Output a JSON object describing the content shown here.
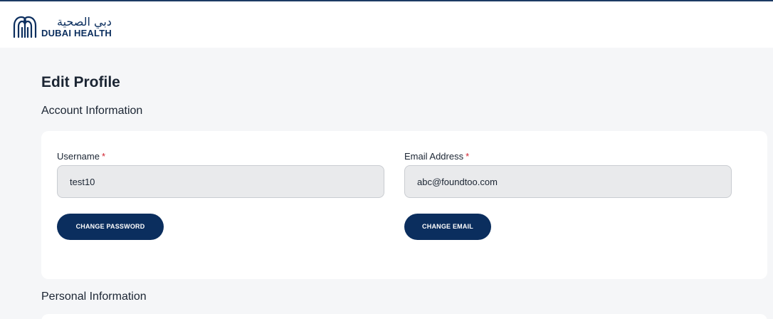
{
  "brand": {
    "arabic_name": "دبي الصحية",
    "english_name": "DUBAI HEALTH",
    "color": "#0b2e5e"
  },
  "page": {
    "title": "Edit Profile"
  },
  "account_section": {
    "title": "Account Information",
    "username": {
      "label": "Username",
      "required_mark": "*",
      "value": "test10"
    },
    "email": {
      "label": "Email Address",
      "required_mark": "*",
      "value": "abc@foundtoo.com"
    },
    "change_password_label": "CHANGE PASSWORD",
    "change_email_label": "CHANGE EMAIL"
  },
  "personal_section": {
    "title": "Personal Information"
  },
  "colors": {
    "primary": "#0b2e5e",
    "required": "#d0202e",
    "background": "#f5f6f8"
  }
}
